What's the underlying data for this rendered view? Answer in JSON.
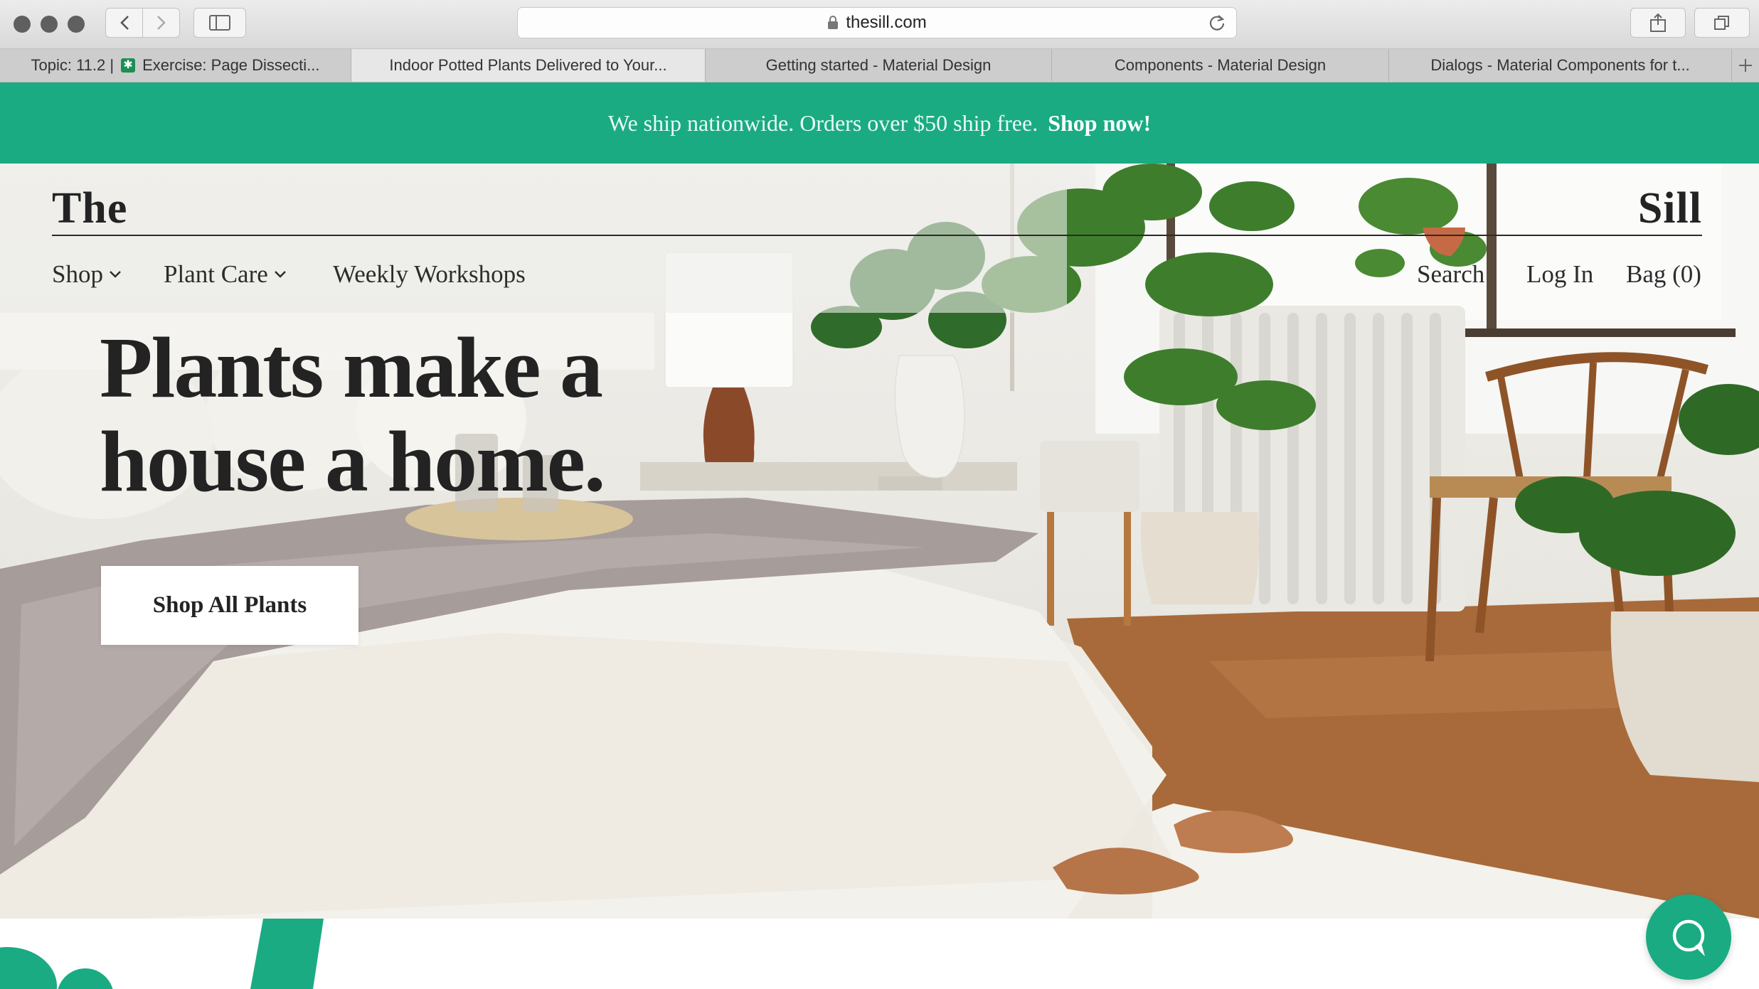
{
  "browser": {
    "url": "thesill.com",
    "tabs": [
      {
        "prefix": "Topic: 11.2 |",
        "label": "Exercise: Page Dissecti...",
        "active": false
      },
      {
        "label": "Indoor Potted Plants Delivered to Your...",
        "active": true
      },
      {
        "label": "Getting started - Material Design",
        "active": false
      },
      {
        "label": "Components - Material Design",
        "active": false
      },
      {
        "label": "Dialogs - Material Components for t...",
        "active": false
      }
    ]
  },
  "promo": {
    "text": "We ship nationwide. Orders over $50 ship free.",
    "link": "Shop now!"
  },
  "header": {
    "logo_left": "The",
    "logo_right": "Sill",
    "nav": {
      "shop": "Shop",
      "plant_care": "Plant Care",
      "workshops": "Weekly Workshops",
      "search": "Search",
      "login": "Log In",
      "bag": "Bag (0)"
    }
  },
  "hero": {
    "headline": "Plants make a house a home.",
    "cta": "Shop All Plants"
  },
  "colors": {
    "brand_green": "#1aab83",
    "text_dark": "#232323"
  },
  "icons": [
    "chevron-left-icon",
    "chevron-right-icon",
    "sidebar-icon",
    "lock-icon",
    "reload-icon",
    "share-icon",
    "tabs-overview-icon",
    "plus-icon",
    "chevron-down-icon",
    "chat-icon"
  ]
}
